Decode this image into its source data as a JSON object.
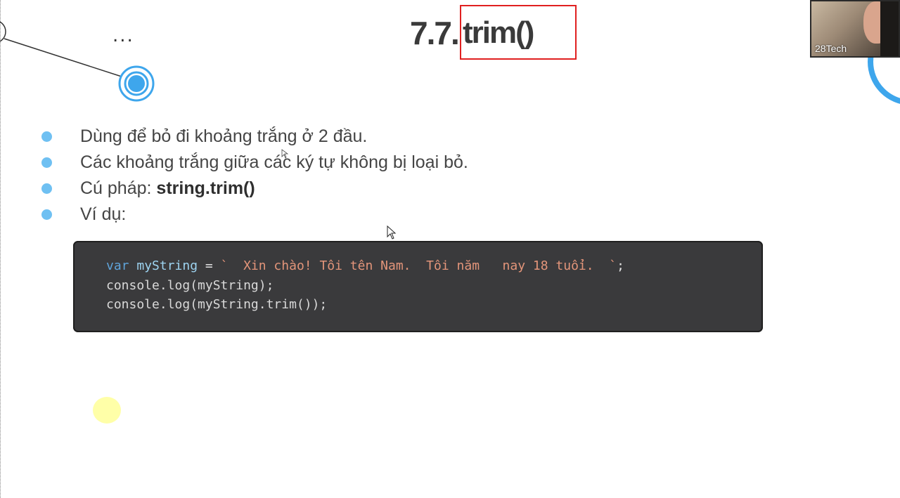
{
  "slide": {
    "ellipsis": "...",
    "title_number": "7.7.",
    "title_function": "trim()"
  },
  "webcam": {
    "label": "28Tech"
  },
  "bullets": [
    {
      "parts": [
        {
          "text": "Dùng để bỏ đi khoảng trắng ở 2 đầu.",
          "bold": false
        }
      ]
    },
    {
      "parts": [
        {
          "text": "Các khoảng trắng giữa các ký tự không bị loại bỏ.",
          "bold": false
        }
      ]
    },
    {
      "parts": [
        {
          "text": "Cú pháp: ",
          "bold": false
        },
        {
          "text": "string.trim()",
          "bold": true
        }
      ]
    },
    {
      "parts": [
        {
          "text": "Ví dụ:",
          "bold": false
        }
      ]
    }
  ],
  "code": {
    "line1": {
      "kw": "var",
      "name": "myString",
      "op": " = ",
      "str": "`  Xin chào! Tôi tên Nam.  Tôi năm   nay 18 tuổi.  `",
      "end": ";"
    },
    "line2": "console.log(myString);",
    "line3": "console.log(myString.trim());"
  },
  "colors": {
    "bullet_dot": "#6fc0f2",
    "title_box": "#e02020",
    "code_bg": "#3a3a3c",
    "string": "#e3957a",
    "keyword": "#5fa3d9"
  },
  "icons": [
    "timeline-node-icon",
    "mouse-cursor-icon",
    "laser-pointer-highlight"
  ]
}
